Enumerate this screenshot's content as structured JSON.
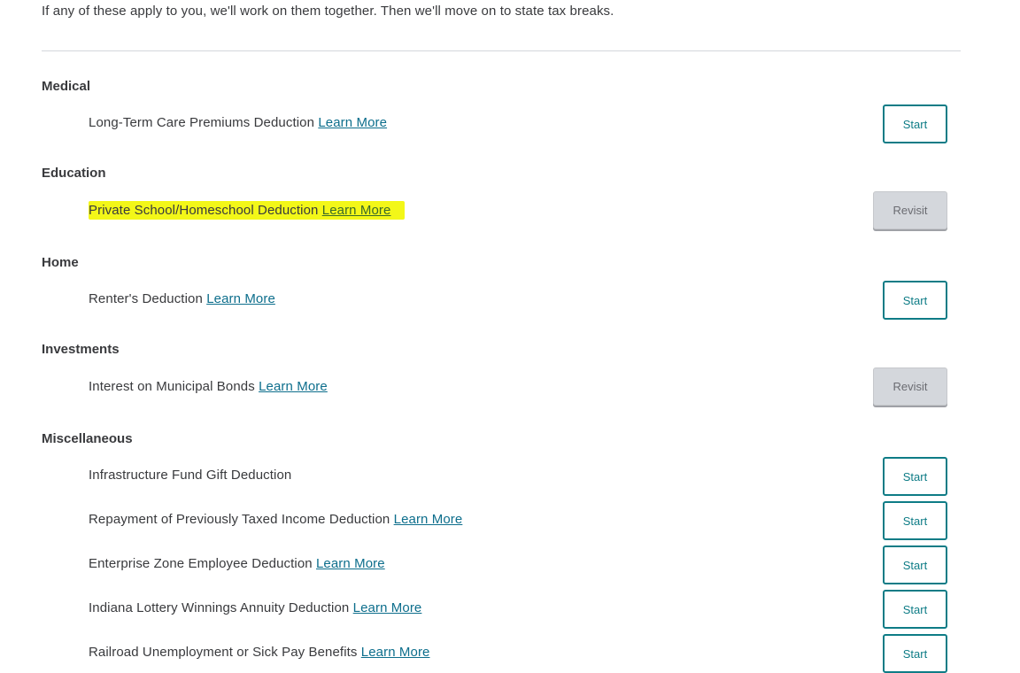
{
  "intro": "If any of these apply to you, we'll work on them together. Then we'll move on to state tax breaks.",
  "learn_more": "Learn More",
  "buttons": {
    "start": "Start",
    "revisit": "Revisit"
  },
  "categories": [
    {
      "name": "Medical",
      "items": [
        {
          "label": "Long-Term Care Premiums Deduction",
          "learn_more": true,
          "action": "Start"
        }
      ]
    },
    {
      "name": "Education",
      "items": [
        {
          "label": "Private School/Homeschool Deduction",
          "learn_more": true,
          "action": "Revisit",
          "highlighted": true
        }
      ]
    },
    {
      "name": "Home",
      "items": [
        {
          "label": "Renter's Deduction",
          "learn_more": true,
          "action": "Start"
        }
      ]
    },
    {
      "name": "Investments",
      "items": [
        {
          "label": "Interest on Municipal Bonds",
          "learn_more": true,
          "action": "Revisit"
        }
      ]
    },
    {
      "name": "Miscellaneous",
      "items": [
        {
          "label": "Infrastructure Fund Gift Deduction",
          "learn_more": false,
          "action": "Start"
        },
        {
          "label": "Repayment of Previously Taxed Income Deduction",
          "learn_more": true,
          "action": "Start"
        },
        {
          "label": "Enterprise Zone Employee Deduction",
          "learn_more": true,
          "action": "Start"
        },
        {
          "label": "Indiana Lottery Winnings Annuity Deduction",
          "learn_more": true,
          "action": "Start"
        },
        {
          "label": "Railroad Unemployment or Sick Pay Benefits",
          "learn_more": true,
          "action": "Start"
        }
      ]
    }
  ],
  "colors": {
    "link": "#0d6e8c",
    "start_border": "#0e7c86",
    "highlight": "#f3f718",
    "revisit_bg": "#d4d7dc"
  }
}
